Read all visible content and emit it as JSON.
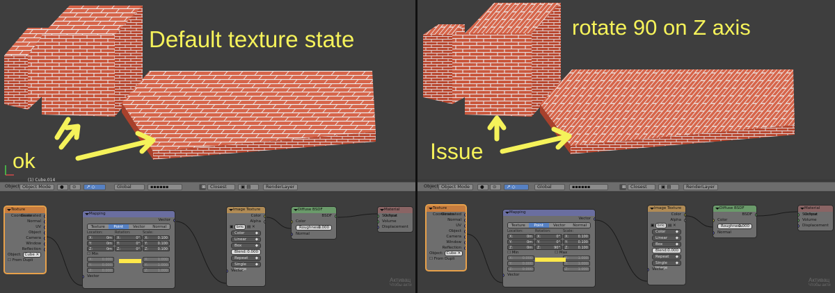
{
  "left": {
    "caption": "Default texture state",
    "label_ok": "ok",
    "object_info": "(1) Cube.014"
  },
  "right": {
    "caption": "rotate 90 on Z axis",
    "label_issue": "Issue"
  },
  "header": {
    "object_menu": "Object",
    "mode": "Object Mode",
    "orientation": "Global",
    "snap": "Closest",
    "render_layer": "RenderLayer"
  },
  "nodes": {
    "texcoord": {
      "title": "Texture Coordinate",
      "outputs": [
        "Generated",
        "Normal",
        "UV",
        "Object",
        "Camera",
        "Window",
        "Reflection"
      ],
      "object_label": "Object:",
      "object_value": "Cube",
      "from_dupli": "From Dupli"
    },
    "mapping": {
      "title": "Mapping",
      "output": "Vector",
      "tabs": [
        "Texture",
        "Point",
        "Vector",
        "Normal"
      ],
      "selected_tab": "Point",
      "loc_label": "Location:",
      "rot_label": "Rotation:",
      "scale_label": "Scale:",
      "loc": [
        [
          "X:",
          "0m"
        ],
        [
          "Y:",
          "0m"
        ],
        [
          "Z:",
          "0m"
        ]
      ],
      "rot_left": [
        [
          "X:",
          "0°"
        ],
        [
          "Y:",
          "0°"
        ],
        [
          "Z:",
          "0°"
        ]
      ],
      "rot_right": [
        [
          "X:",
          "0°"
        ],
        [
          "Y:",
          "0°"
        ],
        [
          "Z:",
          "90°"
        ]
      ],
      "scale": [
        [
          "X:",
          "0.100"
        ],
        [
          "Y:",
          "0.100"
        ],
        [
          "Z:",
          "0.100"
        ]
      ],
      "min_label": "Min",
      "max_label": "Max",
      "min": [
        [
          "X:",
          "0.000"
        ],
        [
          "Y:",
          "0.000"
        ],
        [
          "Z:",
          "0.000"
        ]
      ],
      "max": [
        [
          "X:",
          "1.000"
        ],
        [
          "Y:",
          "1.000"
        ],
        [
          "Z:",
          "1.000"
        ]
      ],
      "input": "Vector"
    },
    "image": {
      "title": "Image Texture",
      "out_color": "Color",
      "out_alpha": "Alpha",
      "image_name": "bric",
      "color_space": "Color",
      "interpolation": "Linear",
      "projection": "Box",
      "blend_label": "Blend:",
      "blend_value": "0.000",
      "extension": "Repeat",
      "source": "Single Image",
      "input": "Vector"
    },
    "diffuse": {
      "title": "Diffuse BSDF",
      "output": "BSDF",
      "in_color": "Color",
      "roughness_label": "Roughness:",
      "roughness_value": "0.000",
      "in_normal": "Normal"
    },
    "output": {
      "title": "Material Output",
      "inputs": [
        "Surface",
        "Volume",
        "Displacement"
      ]
    }
  },
  "watermark": {
    "line1": "Активац",
    "line2": "Чтобы акти"
  },
  "colors": {
    "caption": "#f5f25a",
    "brick": "#c9553a",
    "highlight": "#ffe84a",
    "active_node": "#e8a14a"
  }
}
